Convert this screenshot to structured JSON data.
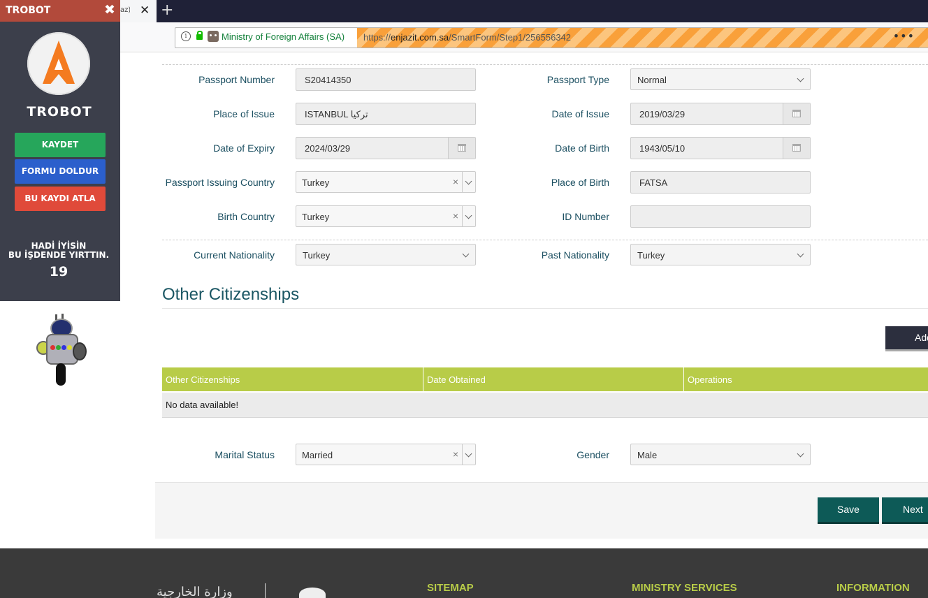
{
  "browser": {
    "tab_title": "az)",
    "tab_close": "✕",
    "new_tab": "+",
    "org_name": "Ministry of Foreign Affairs (SA)",
    "url_prefix": "https://",
    "url_domain": "enjazit.com.sa",
    "url_path": "/SmartForm/Step1/256556342",
    "more": "•••"
  },
  "trobot": {
    "header_title": "TROBOT",
    "close": "✖",
    "name": "TROBOT",
    "buttons": {
      "save": "KAYDET",
      "fill": "FORMU DOLDUR",
      "skip": "BU KAYDI ATLA"
    },
    "colors": {
      "save": "#26a65b",
      "fill": "#2b5fcc",
      "skip": "#e04a3a",
      "header": "#b24a3b"
    },
    "message_line1": "HADİ İYİSİN",
    "message_line2": "BU İŞDENDE YIRTTIN.",
    "count": "19"
  },
  "form": {
    "passport_number": {
      "label": "Passport Number",
      "value": "S20414350"
    },
    "passport_type": {
      "label": "Passport Type",
      "value": "Normal"
    },
    "place_of_issue": {
      "label": "Place of Issue",
      "value": "ISTANBUL تركيا"
    },
    "date_of_issue": {
      "label": "Date of Issue",
      "value": "2019/03/29"
    },
    "date_of_expiry": {
      "label": "Date of Expiry",
      "value": "2024/03/29"
    },
    "date_of_birth": {
      "label": "Date of Birth",
      "value": "1943/05/10"
    },
    "passport_issuing_country": {
      "label": "Passport Issuing Country",
      "value": "Turkey"
    },
    "place_of_birth": {
      "label": "Place of Birth",
      "value": "FATSA"
    },
    "birth_country": {
      "label": "Birth Country",
      "value": "Turkey"
    },
    "id_number": {
      "label": "ID Number",
      "value": ""
    },
    "current_nationality": {
      "label": "Current Nationality",
      "value": "Turkey"
    },
    "past_nationality": {
      "label": "Past Nationality",
      "value": "Turkey"
    },
    "marital_status": {
      "label": "Marital Status",
      "value": "Married"
    },
    "gender": {
      "label": "Gender",
      "value": "Male"
    },
    "clear_glyph": "×"
  },
  "citizenships": {
    "title": "Other Citizenships",
    "add_label": "Add",
    "columns": [
      "Other Citizenships",
      "Date Obtained",
      "Operations"
    ],
    "empty_text": "No data available!",
    "header_color": "#b8cc48"
  },
  "actions": {
    "save_label": "Save",
    "next_label": "Next"
  },
  "footer": {
    "logo_text": "وزارة الخارجية",
    "headings": [
      "SITEMAP",
      "MINISTRY SERVICES",
      "INFORMATION"
    ],
    "heading_color": "#b8cc48"
  }
}
